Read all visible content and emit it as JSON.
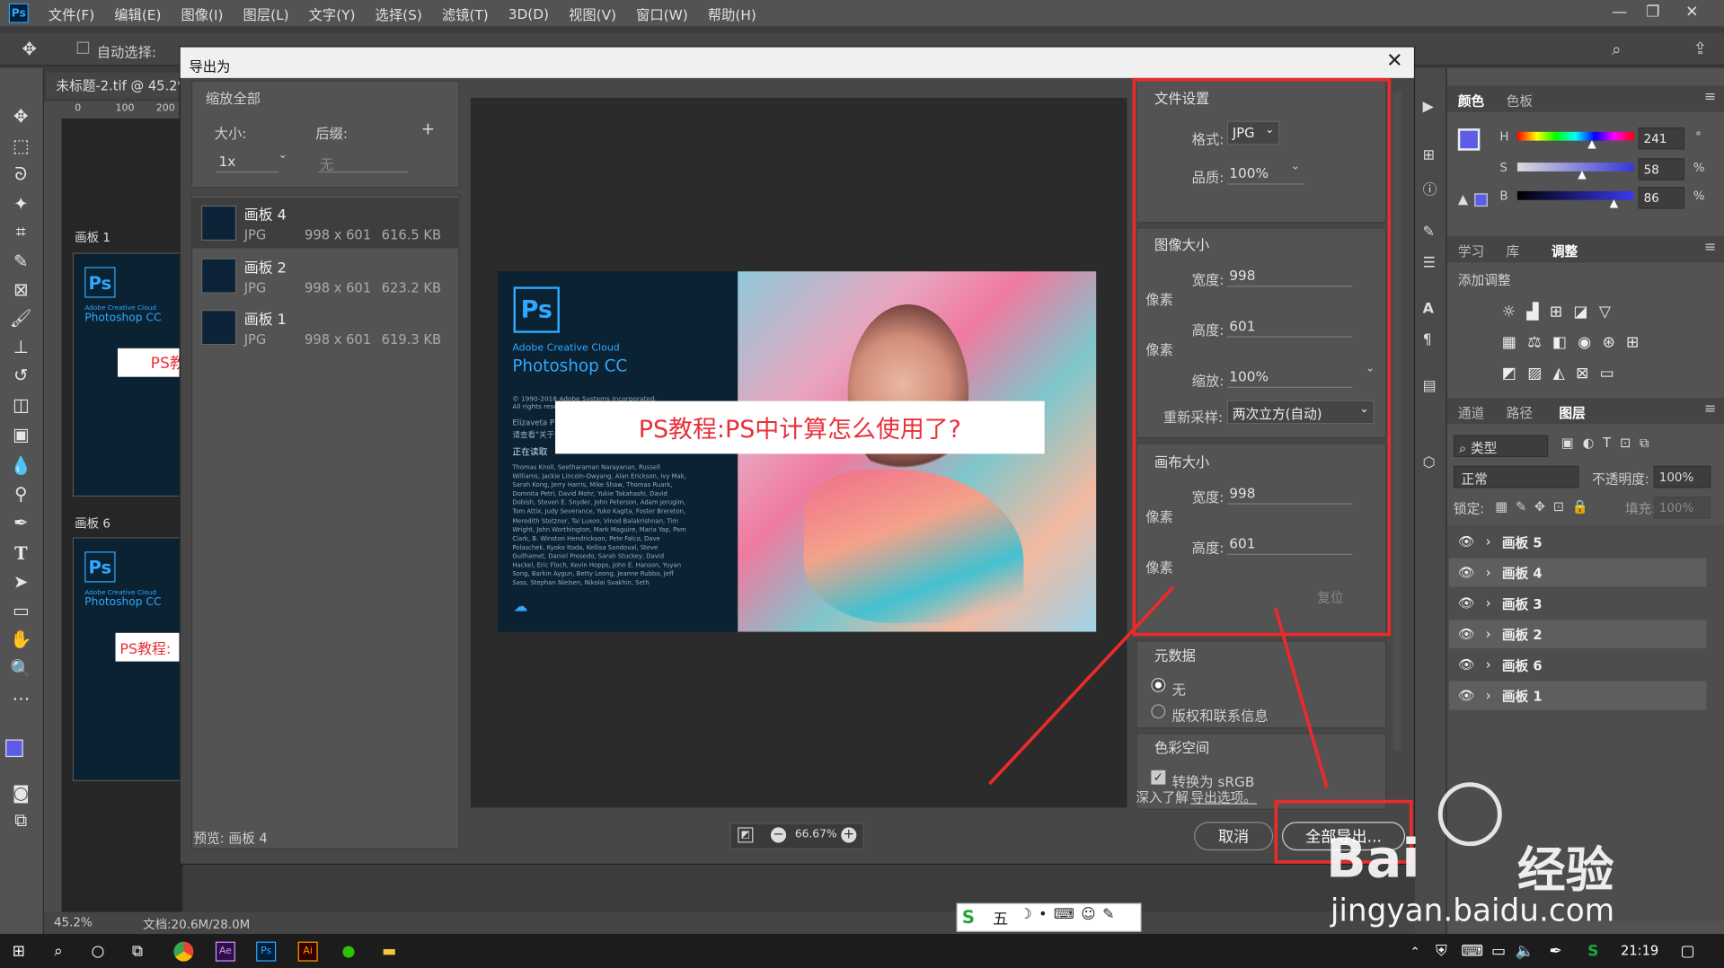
{
  "app": {
    "logo": "Ps",
    "menu": [
      "文件(F)",
      "编辑(E)",
      "图像(I)",
      "图层(L)",
      "文字(Y)",
      "选择(S)",
      "滤镜(T)",
      "3D(D)",
      "视图(V)",
      "窗口(W)",
      "帮助(H)"
    ]
  },
  "options": {
    "auto_select": "自动选择:"
  },
  "document": {
    "tab": "未标题-2.tif @ 45.2%",
    "status_zoom": "45.2%",
    "status_doc": "文档:20.6M/28.0M",
    "ruler_marks": [
      "0",
      "100",
      "200"
    ]
  },
  "canvas": {
    "artboard1": "画板 1",
    "artboard6": "画板 6",
    "ps_label": "PS教",
    "ps_label2": "PS教程:",
    "splash_small": "Adobe Creative Cloud",
    "splash_big": "Photoshop CC"
  },
  "dialog": {
    "title": "导出为",
    "scale_all": "缩放全部",
    "size_label": "大小:",
    "suffix_label": "后缀:",
    "size_value": "1x",
    "suffix_placeholder": "无",
    "add": "+",
    "items": [
      {
        "name": "画板 4",
        "format": "JPG",
        "dims": "998 x 601",
        "size": "616.5 KB"
      },
      {
        "name": "画板 2",
        "format": "JPG",
        "dims": "998 x 601",
        "size": "623.2 KB"
      },
      {
        "name": "画板 1",
        "format": "JPG",
        "dims": "998 x 601",
        "size": "619.3 KB"
      }
    ],
    "preview_label": "预览: 画板 4",
    "zoom": "66.67%",
    "splash": {
      "logo": "Ps",
      "line1": "Adobe Creative Cloud",
      "line2": "Photoshop CC",
      "copyright": "© 1990-2018 Adobe Systems Incorporated. All rights reserved.",
      "author": "Elizaveta P",
      "see": "请查看\"关于\"",
      "loading": "正在读取",
      "credits": "Thomas Knoll, Seetharaman Narayanan, Russell Williams, Jackie Lincoln-Owyang, Alan Erickson, Ivy Mak, Sarah Kong, Jerry Harris, Mike Shaw, Thomas Ruark, Domnita Petri, David Mohr, Yukie Takahashi, David Dobish, Steven E. Snyder, John Peterson, Adam Jerugim, Tom Attix, Judy Severance, Yuko Kagita, Foster Brereton, Meredith Stotzner, Tai Luxon, Vinod Balakrishnan, Tim Wright, John Worthington, Mark Maguire, Maria Yap, Pam Clark, B. Winston Hendrickson, Pete Falco, Dave Polaschek, Kyoko Itoda, Kellisa Sandoval, Steve Guilhamet, Daniel Presedo, Sarah Stuckey, David Hackel, Eric Floch, Kevin Hopps, John E. Hanson, Yuyan Song, Barkin Aygun, Betty Leong, Jeanne Rubbo, Jeff Sass, Stephan Nielsen, Nikolai Svakhin, Seth",
      "banner": "PS教程:PS中计算怎么使用了?"
    },
    "file_settings": "文件设置",
    "format_label": "格式:",
    "format_value": "JPG",
    "quality_label": "品质:",
    "quality_value": "100%",
    "image_size": "图像大小",
    "width_label": "宽度:",
    "width_value": "998",
    "height_label": "高度:",
    "height_value": "601",
    "unit": "像素",
    "scale_label": "缩放:",
    "scale_value": "100%",
    "resample_label": "重新采样:",
    "resample_value": "两次立方(自动)",
    "canvas_size": "画布大小",
    "canvas_width": "998",
    "canvas_height": "601",
    "reset": "复位",
    "metadata": "元数据",
    "meta_none": "无",
    "meta_copyright": "版权和联系信息",
    "colorspace": "色彩空间",
    "convert_srgb": "转换为 sRGB",
    "learn_more": "深入了解",
    "export_options": "导出选项。",
    "cancel": "取消",
    "export_all": "全部导出..."
  },
  "right_panels": {
    "tabs_top": [
      "颜色",
      "色板"
    ],
    "h_label": "H",
    "s_label": "S",
    "b_label": "B",
    "h_value": "241",
    "s_value": "58",
    "b_value": "86",
    "deg": "°",
    "pct": "%",
    "tabs_mid": [
      "学习",
      "库",
      "调整"
    ],
    "add_adjustment": "添加调整",
    "tabs_layers": [
      "通道",
      "路径",
      "图层"
    ],
    "kind": "类型",
    "blend": "正常",
    "opacity_label": "不透明度:",
    "opacity_value": "100%",
    "lock_label": "锁定:",
    "fill_label": "填充:",
    "fill_value": "100%",
    "layers": [
      "画板 5",
      "画板 4",
      "画板 3",
      "画板 2",
      "画板 6",
      "画板 1"
    ]
  },
  "taskbar": {
    "time": "21:19",
    "ime": "五"
  },
  "watermark": {
    "brand": "Bai",
    "brand2": "经验",
    "url": "jingyan.baidu.com"
  },
  "colors": {
    "accent": "#31a8ff",
    "red": "#ea2b2b",
    "swatch": "#5c5ce6"
  }
}
